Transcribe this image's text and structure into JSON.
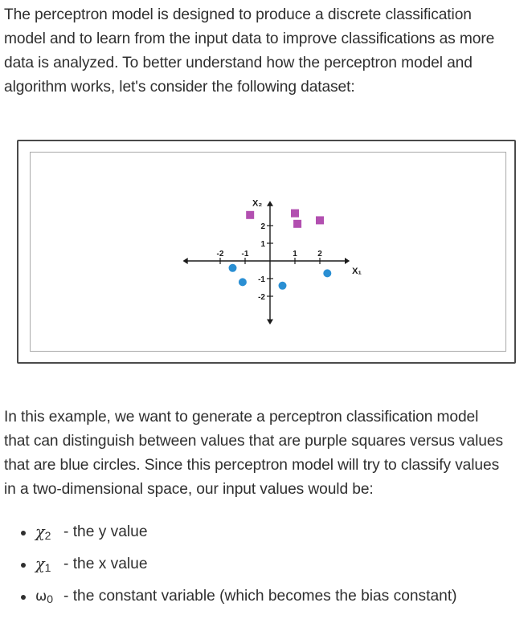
{
  "intro_paragraph": [
    "The perceptron model is designed to produce a discrete classification",
    "model and to learn from the input data to improve classifications as more",
    "data is analyzed. To better understand how the perceptron model and",
    "algorithm works, let's consider the following dataset:"
  ],
  "figure": {
    "x_axis_label": "X₁",
    "y_axis_label": "X₂",
    "x_ticks": [
      "-2",
      "-1",
      "1",
      "2"
    ],
    "y_ticks": [
      "2",
      "1",
      "-1",
      "-2"
    ],
    "colors": {
      "square": "#b24fb0",
      "circle": "#2a8fd3",
      "axis": "#1a1a1a"
    }
  },
  "chart_data": {
    "type": "scatter",
    "title": "",
    "xlabel": "X₁",
    "ylabel": "X₂",
    "xlim": [
      -2.6,
      3.2
    ],
    "ylim": [
      -3,
      3.4
    ],
    "series": [
      {
        "marker": "square",
        "color": "#b24fb0",
        "points": [
          [
            -0.8,
            2.6
          ],
          [
            1.0,
            2.7
          ],
          [
            1.1,
            2.1
          ],
          [
            2.0,
            2.3
          ]
        ]
      },
      {
        "marker": "circle",
        "color": "#2a8fd3",
        "points": [
          [
            -1.5,
            -0.4
          ],
          [
            -1.1,
            -1.2
          ],
          [
            0.5,
            -1.4
          ],
          [
            2.3,
            -0.7
          ]
        ]
      }
    ]
  },
  "example_paragraph": [
    "In this example, we want to generate a perceptron classification model",
    "that can distinguish between values that are purple squares versus values",
    "that are blue circles. Since this perceptron model will try to classify values",
    "in a two-dimensional space, our input values would be:"
  ],
  "bullets": [
    {
      "symbol": "χ",
      "subscript": "2",
      "text": "- the y value"
    },
    {
      "symbol": "χ",
      "subscript": "1",
      "text": "- the x value"
    },
    {
      "symbol": "ω",
      "subscript": "0",
      "text": "- the constant variable (which becomes the bias constant)"
    }
  ]
}
